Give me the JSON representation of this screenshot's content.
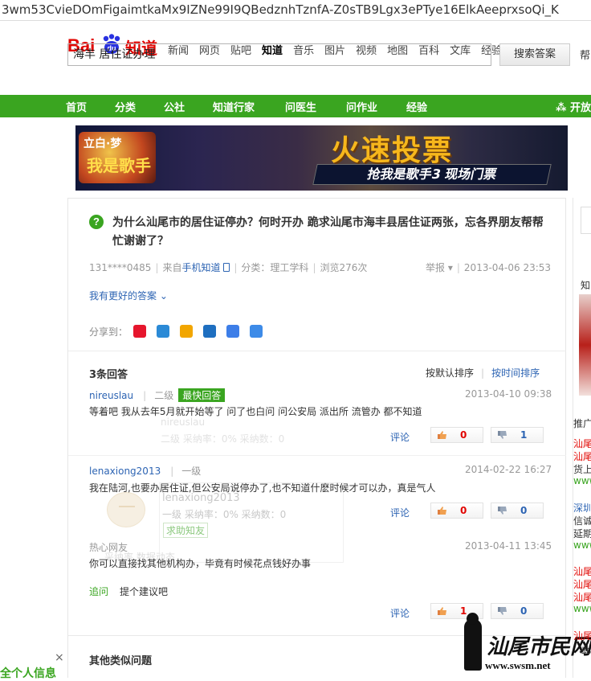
{
  "url_text": "3wm53CvieDOmFigaimtkaMx9IZNe99I9QBedznhTznfA-Z0sTB9Lgx3ePTye16ElkAeeprxsoQi_K",
  "logo": {
    "bai": "Bai",
    "du": "du",
    "zhidao": "知道"
  },
  "top_nav": [
    "新闻",
    "网页",
    "贴吧",
    "知道",
    "音乐",
    "图片",
    "视频",
    "地图",
    "百科",
    "文库",
    "经验"
  ],
  "search": {
    "value": "海丰 居住证办理",
    "button": "搜索答案",
    "extra": "帮"
  },
  "green_nav": [
    "首页",
    "分类",
    "公社",
    "知道行家",
    "问医生",
    "问作业",
    "经验"
  ],
  "green_share": "开放",
  "banner": {
    "show_line1": "立白·梦",
    "show_line2": "我是歌手",
    "headline": "火速投票",
    "subline": "抢我是歌手3 现场门票"
  },
  "question": {
    "title": "为什么汕尾市的居住证停办？何时开办 跪求汕尾市海丰县居住证两张，忘各界朋友帮帮忙谢谢了？",
    "asker": "131****0485",
    "source_prefix": "来自",
    "source": "手机知道",
    "category_prefix": "分类：",
    "category": "理工学科",
    "views": "浏览276次",
    "report": "举报",
    "date": "2013-04-06 23:53",
    "better_answer": "我有更好的答案"
  },
  "share_label": "分享到：",
  "share_icons": [
    "weibo-icon",
    "qzone-icon",
    "qq-icon",
    "renren-icon",
    "tieba-icon",
    "more-icon"
  ],
  "share_colors": [
    "#e6162d",
    "#2b8ad6",
    "#f2a600",
    "#1e6fc0",
    "#3d7ee8",
    "#3d8be8"
  ],
  "answers_header": {
    "count": "3条回答",
    "sort_default": "按默认排序",
    "sort_time": "按时间排序"
  },
  "answers": [
    {
      "user": "nireuslau",
      "level": "二级",
      "badge": "最快回答",
      "date": "2013-04-10 09:38",
      "text": "等着吧  我从去年5月就开始等了  问了也白问  问公安局 派出所  流管办 都不知道",
      "comment": "评论",
      "up": "0",
      "down": "1"
    },
    {
      "user": "lenaxiong2013",
      "level": "一级",
      "date": "2014-02-22 16:27",
      "text": "我在陆河,也要办居住证,但公安局说停办了,也不知道什麽时候才可以办，真是气人",
      "comment": "评论",
      "up": "0",
      "down": "0"
    },
    {
      "user": "热心网友",
      "date": "2013-04-11 13:45",
      "text": "你可以直接找其他机构办，毕竟有时候花点钱好办事",
      "comment": "评论",
      "up": "1",
      "down": "0"
    }
  ],
  "ghost": {
    "name1": "nireuslau",
    "stats1": "二级  采纳率：0%   采纳数：0",
    "name2": "lenaxiong2013",
    "stats2": "一级  采纳率：0%   采纳数：0",
    "btn": "求助知友",
    "more": "采纳率 数据动态"
  },
  "adopt": {
    "link": "追问",
    "text": "提个建议吧"
  },
  "similar": "其他类似问题",
  "left_popup": {
    "close": "×",
    "text": "全个人信息"
  },
  "watermark": {
    "cn": "汕尾市民网",
    "url": "www.swsm.net"
  },
  "side": [
    "知",
    "推广",
    "汕尾",
    "汕尾",
    "货上",
    "www",
    "深圳",
    "信诚",
    "延期",
    "www",
    "汕尾",
    "汕尾",
    "汕尾",
    "www",
    "汕尾",
    "此"
  ]
}
